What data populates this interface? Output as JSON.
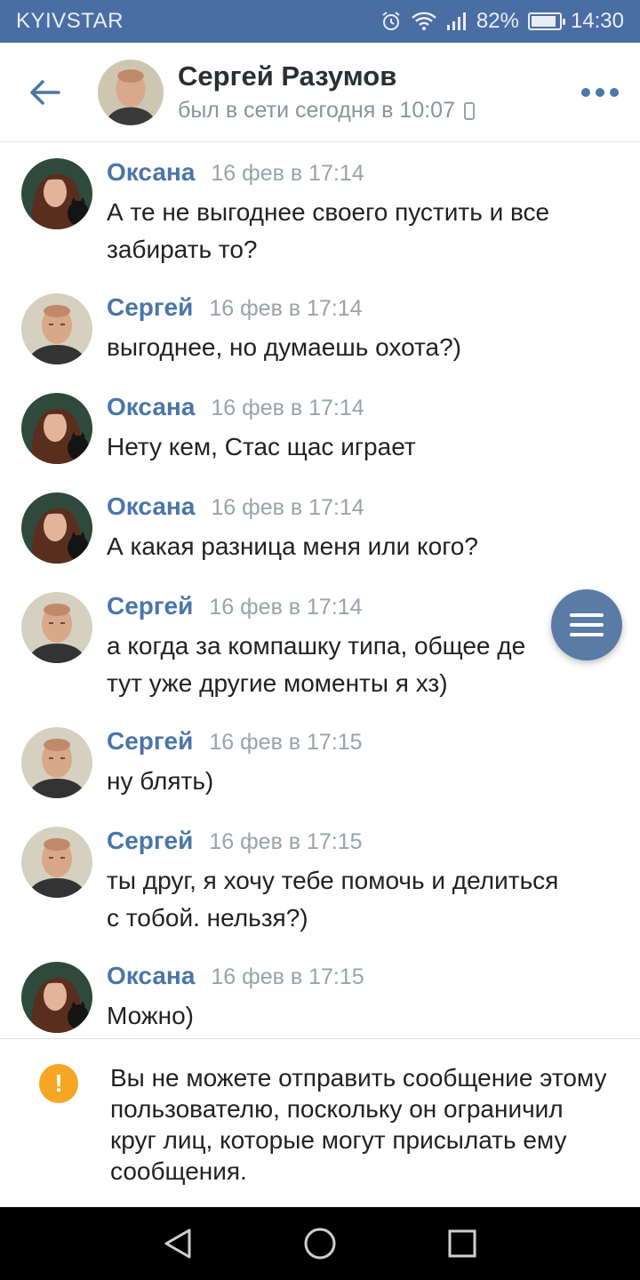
{
  "status_bar": {
    "carrier": "KYIVSTAR",
    "battery": "82%",
    "time": "14:30",
    "icons": [
      "alarm-icon",
      "wifi-icon",
      "signal-icon",
      "battery-icon"
    ]
  },
  "header": {
    "back_icon": "arrow-left-icon",
    "name": "Сергей Разумов",
    "status": "был в сети сегодня в 10:07",
    "more_icon": "more-dots-icon"
  },
  "messages": [
    {
      "author": "Оксана",
      "time": "16 фев в 17:14",
      "lines": [
        "А те не выгоднее своего пустить и все",
        "забирать то?"
      ],
      "avatar": "oksana"
    },
    {
      "author": "Сергей",
      "time": "16 фев в 17:14",
      "lines": [
        "выгоднее, но думаешь охота?)"
      ],
      "avatar": "sergey"
    },
    {
      "author": "Оксана",
      "time": "16 фев в 17:14",
      "lines": [
        "Нету кем, Стас щас играет"
      ],
      "avatar": "oksana"
    },
    {
      "author": "Оксана",
      "time": "16 фев в 17:14",
      "lines": [
        "А какая разница меня или кого?"
      ],
      "avatar": "oksana"
    },
    {
      "author": "Сергей",
      "time": "16 фев в 17:14",
      "lines": [
        "а когда за компашку типа, общее де",
        "тут уже другие моменты я хз)"
      ],
      "avatar": "sergey"
    },
    {
      "author": "Сергей",
      "time": "16 фев в 17:15",
      "lines": [
        "ну блять)"
      ],
      "avatar": "sergey"
    },
    {
      "author": "Сергей",
      "time": "16 фев в 17:15",
      "lines": [
        "ты друг, я хочу тебе помочь и делиться",
        "с тобой. нельзя?)"
      ],
      "avatar": "sergey"
    },
    {
      "author": "Оксана",
      "time": "16 фев в 17:15",
      "lines": [
        "Можно)"
      ],
      "avatar": "oksana"
    }
  ],
  "fab": {
    "icon": "menu-icon"
  },
  "notice": {
    "icon": "warning-icon",
    "icon_glyph": "!",
    "text": "Вы не можете отправить сообщение этому пользователю, поскольку он ограничил круг лиц, которые могут присылать ему сообщения."
  },
  "navbar": {
    "icons": [
      "back-triangle-icon",
      "home-circle-icon",
      "recents-square-icon"
    ]
  },
  "colors": {
    "status_bar": "#4a6ea3",
    "accent": "#4a76a8",
    "time_gray": "#9aa2aa",
    "warning": "#f5a623",
    "fab": "#5a7ba6"
  }
}
